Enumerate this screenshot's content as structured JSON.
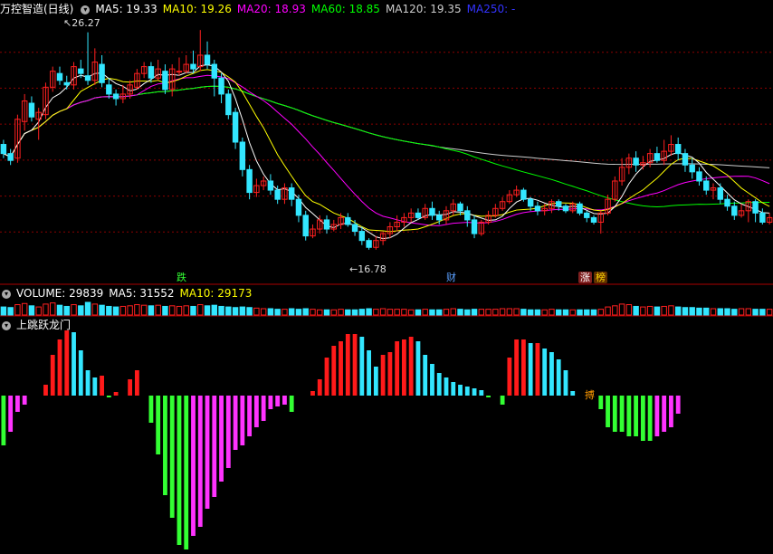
{
  "header": {
    "stock_title": "万控智造(日线)",
    "ma_labels": [
      {
        "text": "MA5: 19.33",
        "color": "#ffffff"
      },
      {
        "text": "MA10: 19.26",
        "color": "#ffff00"
      },
      {
        "text": "MA20: 18.93",
        "color": "#ff00ff"
      },
      {
        "text": "MA60: 18.85",
        "color": "#00ff00"
      },
      {
        "text": "MA120: 19.35",
        "color": "#cccccc"
      },
      {
        "text": "MA250: -",
        "color": "#3333ff"
      }
    ]
  },
  "volume_header": {
    "volume": "VOLUME: 29839",
    "ma5": "MA5: 31552",
    "ma10": "MA10: 29173"
  },
  "indicator_header": {
    "title": "上跳跃龙门"
  },
  "annotations": {
    "high": "26.27",
    "low": "16.78",
    "tags": [
      "跌",
      "财",
      "涨",
      "榜",
      "搏"
    ]
  },
  "colors": {
    "up": "#ff2020",
    "down": "#33e6ff",
    "ma5": "#ffffff",
    "ma10": "#ffff00",
    "ma20": "#ff00ff",
    "ma60": "#00ff00",
    "ma120": "#cccccc",
    "ind_pos_strong": "#ff1a1a",
    "ind_pos_weak": "#33e6ff",
    "ind_neg_strong": "#33ff33",
    "ind_neg_weak": "#ff33ff",
    "grid": "#8b0000"
  },
  "chart_data": {
    "type": "candlestick",
    "price_range": [
      16.0,
      27.0
    ],
    "high": 26.27,
    "low": 16.78,
    "ohlc": [
      [
        21.4,
        21.0,
        21.6,
        20.8
      ],
      [
        21.0,
        20.7,
        21.2,
        20.5
      ],
      [
        20.8,
        22.5,
        22.7,
        20.6
      ],
      [
        22.4,
        23.3,
        23.6,
        22.0
      ],
      [
        23.2,
        22.6,
        23.5,
        22.4
      ],
      [
        22.5,
        22.8,
        23.0,
        21.6
      ],
      [
        22.7,
        23.9,
        24.1,
        22.5
      ],
      [
        23.9,
        24.6,
        24.8,
        23.7
      ],
      [
        24.5,
        24.2,
        24.8,
        24.0
      ],
      [
        24.1,
        24.0,
        24.4,
        23.8
      ],
      [
        24.0,
        24.8,
        25.0,
        23.8
      ],
      [
        24.7,
        24.5,
        25.1,
        24.3
      ],
      [
        24.4,
        24.2,
        26.3,
        24.0
      ],
      [
        24.2,
        25.0,
        25.6,
        24.0
      ],
      [
        24.9,
        24.1,
        25.3,
        23.9
      ],
      [
        24.0,
        23.6,
        24.3,
        23.4
      ],
      [
        23.6,
        23.4,
        23.8,
        23.1
      ],
      [
        23.4,
        23.6,
        24.0,
        23.2
      ],
      [
        23.6,
        24.0,
        24.2,
        23.4
      ],
      [
        23.9,
        24.5,
        24.7,
        23.8
      ],
      [
        24.5,
        24.8,
        25.0,
        24.3
      ],
      [
        24.8,
        24.3,
        25.0,
        24.1
      ],
      [
        24.3,
        24.7,
        25.1,
        24.2
      ],
      [
        24.6,
        23.8,
        24.9,
        23.6
      ],
      [
        23.8,
        24.7,
        24.9,
        23.5
      ],
      [
        24.6,
        24.6,
        25.2,
        24.4
      ],
      [
        24.6,
        24.9,
        25.3,
        24.5
      ],
      [
        24.9,
        24.7,
        25.5,
        24.5
      ],
      [
        24.8,
        25.3,
        26.4,
        24.6
      ],
      [
        25.3,
        24.9,
        25.9,
        24.7
      ],
      [
        24.9,
        24.3,
        25.1,
        23.5
      ],
      [
        24.3,
        23.6,
        24.5,
        23.2
      ],
      [
        23.6,
        22.7,
        23.8,
        22.5
      ],
      [
        22.8,
        21.5,
        23.0,
        21.2
      ],
      [
        21.5,
        20.3,
        21.7,
        20.0
      ],
      [
        20.3,
        19.3,
        20.5,
        19.0
      ],
      [
        19.3,
        19.6,
        19.9,
        19.1
      ],
      [
        19.6,
        19.8,
        20.0,
        19.4
      ],
      [
        19.8,
        19.4,
        20.1,
        19.2
      ],
      [
        19.4,
        19.0,
        19.6,
        18.8
      ],
      [
        19.0,
        19.5,
        19.7,
        18.8
      ],
      [
        19.5,
        19.0,
        19.7,
        18.7
      ],
      [
        19.0,
        18.3,
        19.2,
        18.0
      ],
      [
        18.3,
        17.4,
        18.5,
        17.2
      ],
      [
        17.4,
        17.7,
        17.9,
        17.3
      ],
      [
        17.7,
        18.1,
        18.3,
        17.5
      ],
      [
        18.1,
        17.7,
        18.3,
        17.5
      ],
      [
        17.7,
        17.9,
        18.1,
        17.6
      ],
      [
        17.9,
        18.2,
        18.4,
        17.7
      ],
      [
        18.2,
        17.9,
        18.4,
        17.8
      ],
      [
        17.9,
        17.6,
        18.1,
        17.4
      ],
      [
        17.6,
        17.2,
        17.8,
        17.0
      ],
      [
        17.2,
        16.9,
        17.3,
        16.8
      ],
      [
        16.9,
        17.2,
        17.4,
        16.8
      ],
      [
        17.2,
        17.5,
        17.6,
        17.0
      ],
      [
        17.5,
        17.8,
        18.0,
        17.3
      ],
      [
        17.8,
        18.0,
        18.3,
        17.6
      ],
      [
        18.0,
        18.2,
        18.4,
        17.8
      ],
      [
        18.2,
        18.4,
        18.6,
        18.0
      ],
      [
        18.4,
        18.2,
        18.6,
        18.1
      ],
      [
        18.2,
        18.6,
        18.8,
        18.1
      ],
      [
        18.6,
        18.3,
        18.9,
        18.1
      ],
      [
        18.3,
        18.1,
        18.5,
        17.9
      ],
      [
        18.1,
        18.5,
        18.7,
        17.9
      ],
      [
        18.5,
        18.8,
        19.0,
        18.3
      ],
      [
        18.8,
        18.5,
        18.9,
        18.3
      ],
      [
        18.5,
        18.1,
        18.7,
        17.8
      ],
      [
        18.1,
        17.5,
        18.3,
        17.3
      ],
      [
        17.5,
        18.0,
        18.1,
        17.4
      ],
      [
        18.0,
        18.3,
        18.5,
        17.9
      ],
      [
        18.3,
        18.6,
        18.8,
        18.2
      ],
      [
        18.6,
        18.9,
        19.1,
        18.5
      ],
      [
        18.9,
        19.2,
        19.4,
        18.8
      ],
      [
        19.2,
        19.4,
        19.6,
        19.1
      ],
      [
        19.4,
        19.0,
        19.5,
        18.9
      ],
      [
        19.0,
        18.7,
        19.1,
        18.5
      ],
      [
        18.7,
        18.5,
        18.9,
        18.3
      ],
      [
        18.5,
        18.6,
        18.8,
        18.3
      ],
      [
        18.6,
        18.9,
        19.0,
        18.4
      ],
      [
        18.9,
        18.7,
        19.0,
        18.5
      ],
      [
        18.7,
        18.5,
        18.8,
        18.4
      ],
      [
        18.5,
        18.8,
        18.9,
        18.4
      ],
      [
        18.8,
        18.4,
        18.9,
        18.3
      ],
      [
        18.4,
        18.2,
        18.5,
        18.0
      ],
      [
        18.2,
        18.0,
        18.3,
        17.9
      ],
      [
        18.0,
        18.4,
        18.5,
        17.5
      ],
      [
        18.4,
        19.0,
        19.2,
        18.3
      ],
      [
        19.0,
        19.8,
        20.0,
        18.9
      ],
      [
        19.8,
        20.4,
        20.8,
        19.6
      ],
      [
        20.4,
        20.8,
        21.0,
        20.1
      ],
      [
        20.8,
        20.5,
        21.1,
        20.2
      ],
      [
        20.5,
        20.6,
        20.9,
        20.3
      ],
      [
        20.6,
        21.0,
        21.2,
        20.4
      ],
      [
        21.0,
        20.7,
        21.3,
        20.6
      ],
      [
        20.7,
        21.1,
        21.6,
        20.5
      ],
      [
        21.1,
        21.4,
        21.8,
        20.9
      ],
      [
        21.4,
        21.0,
        21.7,
        20.7
      ],
      [
        21.0,
        20.5,
        21.2,
        20.2
      ],
      [
        20.5,
        20.2,
        20.8,
        19.9
      ],
      [
        20.2,
        19.8,
        20.4,
        19.6
      ],
      [
        19.8,
        19.4,
        20.0,
        19.2
      ],
      [
        19.4,
        19.5,
        19.7,
        19.0
      ],
      [
        19.5,
        19.0,
        19.7,
        18.8
      ],
      [
        19.0,
        18.7,
        19.2,
        18.5
      ],
      [
        18.7,
        18.3,
        18.9,
        18.1
      ],
      [
        18.3,
        18.5,
        18.8,
        18.2
      ],
      [
        18.5,
        18.9,
        19.0,
        18.0
      ],
      [
        18.9,
        18.4,
        19.0,
        18.0
      ],
      [
        18.4,
        18.0,
        18.6,
        17.9
      ],
      [
        18.0,
        18.2,
        18.4,
        17.9
      ]
    ],
    "volume": [
      14,
      13,
      18,
      20,
      16,
      14,
      19,
      21,
      17,
      15,
      18,
      16,
      22,
      19,
      17,
      15,
      14,
      15,
      16,
      18,
      17,
      16,
      17,
      15,
      16,
      15,
      16,
      15,
      18,
      16,
      17,
      15,
      14,
      13,
      14,
      13,
      12,
      11,
      11,
      10,
      10,
      11,
      10,
      11,
      10,
      9,
      9,
      9,
      10,
      9,
      9,
      10,
      11,
      10,
      11,
      10,
      10,
      10,
      9,
      9,
      10,
      9,
      9,
      10,
      11,
      10,
      9,
      10,
      10,
      10,
      10,
      11,
      11,
      11,
      10,
      9,
      9,
      9,
      10,
      9,
      9,
      9,
      9,
      9,
      9,
      10,
      14,
      16,
      19,
      18,
      15,
      14,
      15,
      14,
      15,
      16,
      14,
      13,
      13,
      12,
      12,
      11,
      11,
      11,
      10,
      11,
      11,
      10,
      10,
      10
    ],
    "indicator": [
      -55,
      -40,
      -18,
      -10,
      0,
      0,
      12,
      45,
      62,
      72,
      70,
      50,
      28,
      20,
      22,
      -2,
      4,
      0,
      18,
      28,
      0,
      -30,
      -65,
      -110,
      -135,
      -165,
      -170,
      -155,
      -145,
      -125,
      -112,
      -95,
      -80,
      -60,
      -55,
      -45,
      -35,
      -28,
      -15,
      -12,
      -10,
      -18,
      0,
      0,
      5,
      18,
      42,
      55,
      60,
      68,
      68,
      65,
      50,
      32,
      45,
      48,
      60,
      62,
      65,
      60,
      45,
      35,
      25,
      20,
      15,
      12,
      10,
      8,
      6,
      -2,
      0,
      -10,
      42,
      62,
      62,
      58,
      58,
      52,
      48,
      40,
      28,
      5,
      0,
      0,
      0,
      -15,
      -35,
      -40,
      -40,
      -45,
      -45,
      -50,
      -50,
      -45,
      -40,
      -35,
      -20,
      0,
      0,
      0,
      0,
      0,
      0,
      0,
      0,
      0,
      0,
      0
    ]
  }
}
